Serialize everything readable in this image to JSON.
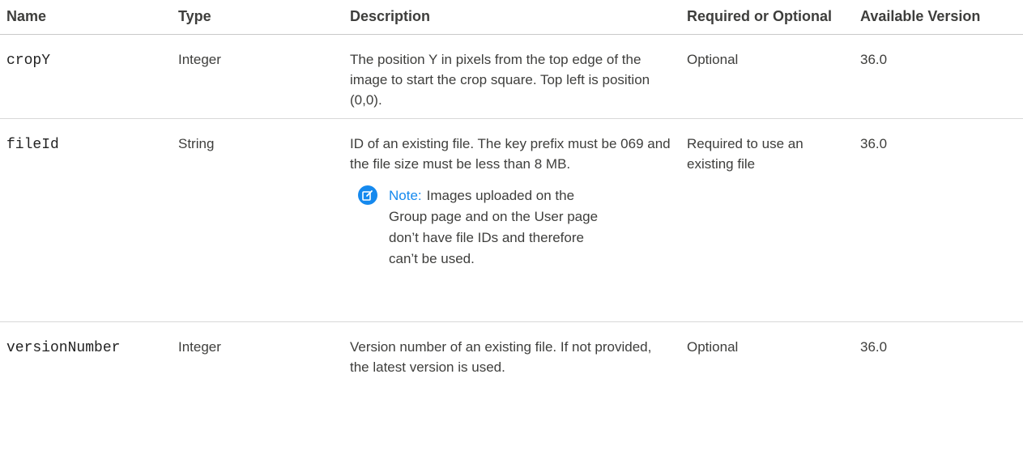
{
  "headers": {
    "name": "Name",
    "type": "Type",
    "description": "Description",
    "required": "Required or Optional",
    "version": "Available Version"
  },
  "rows": [
    {
      "name": "cropY",
      "type": "Integer",
      "description": "The position Y in pixels from the top edge of the image to start the crop square. Top left is position (0,0).",
      "required": "Optional",
      "version": "36.0"
    },
    {
      "name": "fileId",
      "type": "String",
      "description": "ID of an existing file. The key prefix must be 069 and the file size must be less than 8 MB.",
      "note_label": "Note:",
      "note_text": "Images uploaded on the Group page and on the User page don’t have file IDs and therefore can’t be used.",
      "note_icon": "edit-note-icon",
      "required": "Required to use an existing file",
      "version": "36.0"
    },
    {
      "name": "versionNumber",
      "type": "Integer",
      "description": "Version number of an existing file. If not provided, the latest version is used.",
      "required": "Optional",
      "version": "36.0"
    }
  ],
  "colors": {
    "note_accent": "#1589ee",
    "text": "#3e3e3c",
    "rule": "#d8d8d8"
  }
}
